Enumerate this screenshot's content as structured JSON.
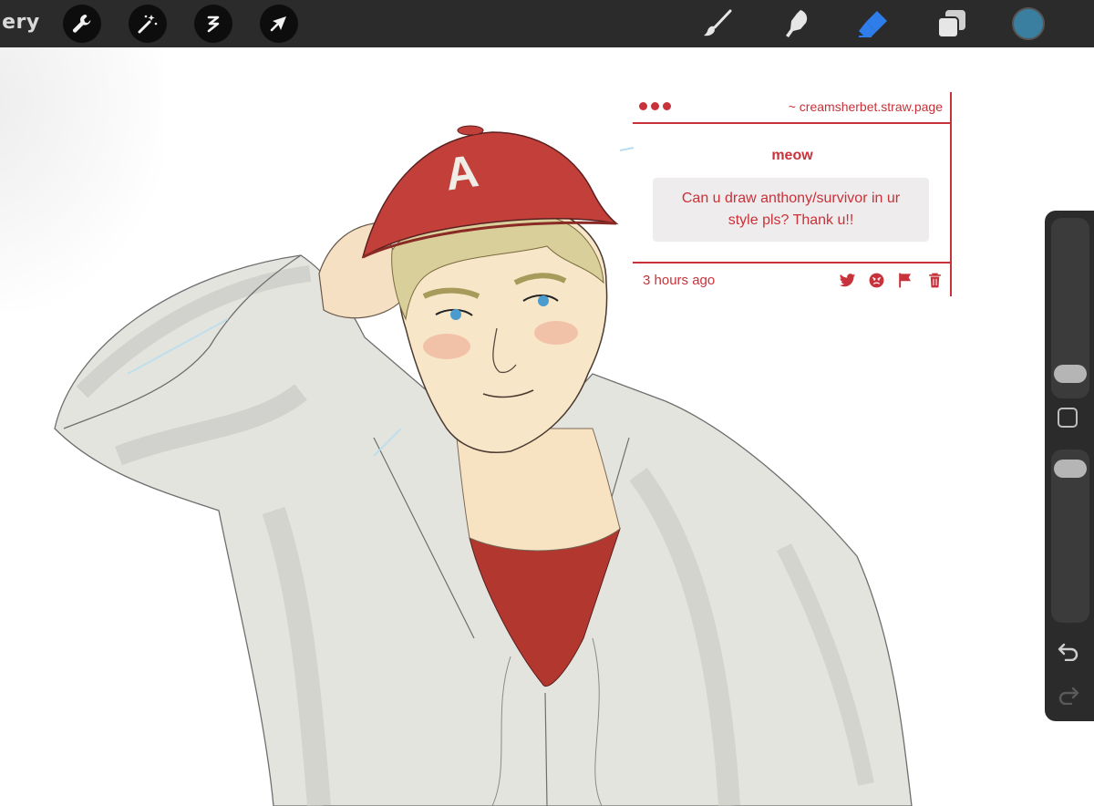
{
  "toolbar": {
    "gallery_label": "llery",
    "left_tools": [
      "wrench-icon",
      "magic-wand-icon",
      "selection-icon",
      "transform-arrow-icon"
    ],
    "right_tools": [
      "brush-icon",
      "smudge-icon",
      "eraser-icon",
      "layers-icon"
    ],
    "active_tool": "eraser-icon",
    "current_color": "#3a7fa0"
  },
  "ask_card": {
    "site": "~ creamsherbet.straw.page",
    "asker": "meow",
    "message": "Can u draw anthony/survivor in ur style pls? Thank u!!",
    "time": "3 hours ago",
    "actions": [
      "twitter-icon",
      "angry-face-icon",
      "flag-icon",
      "trash-icon"
    ],
    "accent_color": "#c8323a"
  },
  "sidebar": {
    "brush_size_level": 0.08,
    "opacity_level": 0.95,
    "controls": [
      "modify-button",
      "undo-button",
      "redo-button"
    ]
  },
  "drawing": {
    "cap_letter": "A"
  }
}
